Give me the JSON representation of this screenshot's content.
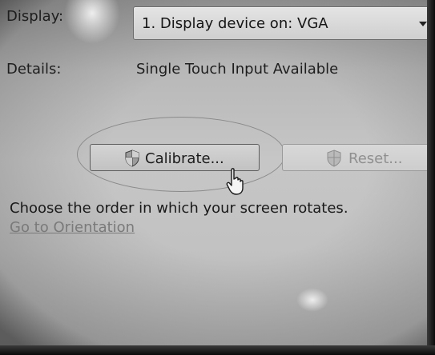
{
  "display": {
    "label": "Display:",
    "selected": "1. Display device on: VGA"
  },
  "details": {
    "label": "Details:",
    "value": "Single Touch Input Available"
  },
  "buttons": {
    "calibrate_label": "Calibrate...",
    "reset_label": "Reset..."
  },
  "orientation": {
    "text": "Choose the order in which your screen rotates.",
    "link": "Go to Orientation"
  },
  "icons": {
    "calibrate": "shield-icon",
    "reset": "shield-icon",
    "dropdown": "chevron-down-icon",
    "cursor": "hand-cursor-icon"
  }
}
